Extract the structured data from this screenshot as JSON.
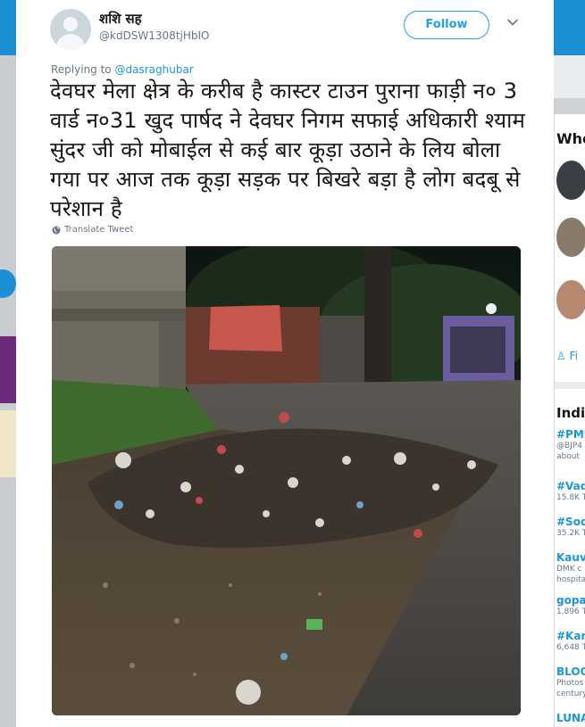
{
  "tweet": {
    "display_name": "शशि सह",
    "handle": "@kdDSW1308tjHbIO",
    "follow_label": "Follow",
    "reply_prefix": "Replying to",
    "reply_mention": "@dasraghubar",
    "text": "देवघर मेला क्षेत्र के करीब है कास्टर टाउन पुराना फाड़ी न० 3 वार्ड न०31 खुद पार्षद ने देवघर निगम सफाई अधिकारी श्याम सुंदर जी को मोबाईल से कई बार  कूड़ा उठाने के लिय बोला गया पर आज तक कूड़ा सड़क पर बिखरे बड़ा है लोग बदबू से परेशान है",
    "translate_label": "Translate Tweet",
    "icons": {
      "avatar": "default-avatar-icon",
      "chevron": "chevron-down-icon",
      "globe": "globe-icon"
    }
  },
  "side_panel": {
    "who_to_follow_title": "Who",
    "follow_link": "Fi",
    "trends_title": "India",
    "trends": [
      {
        "name": "#PMF",
        "detail": "@BJP4",
        "detail2": "about"
      },
      {
        "name": "#Vada",
        "detail": "15.8K T"
      },
      {
        "name": "#Soch",
        "detail": "35.2K T"
      },
      {
        "name": "Kauve",
        "detail": "DMK c",
        "detail2": "hospita"
      },
      {
        "name": "gopal",
        "detail": "1,896 T"
      },
      {
        "name": "#Karu",
        "detail": "6,648 T"
      },
      {
        "name": "BLOO",
        "detail": "Photos",
        "detail2": "century"
      },
      {
        "name": "LUNA",
        "detail": ""
      }
    ]
  },
  "colors": {
    "brand_blue": "#1da1f2",
    "link_blue": "#1b95e0",
    "header_blue": "#1d8fd4"
  }
}
